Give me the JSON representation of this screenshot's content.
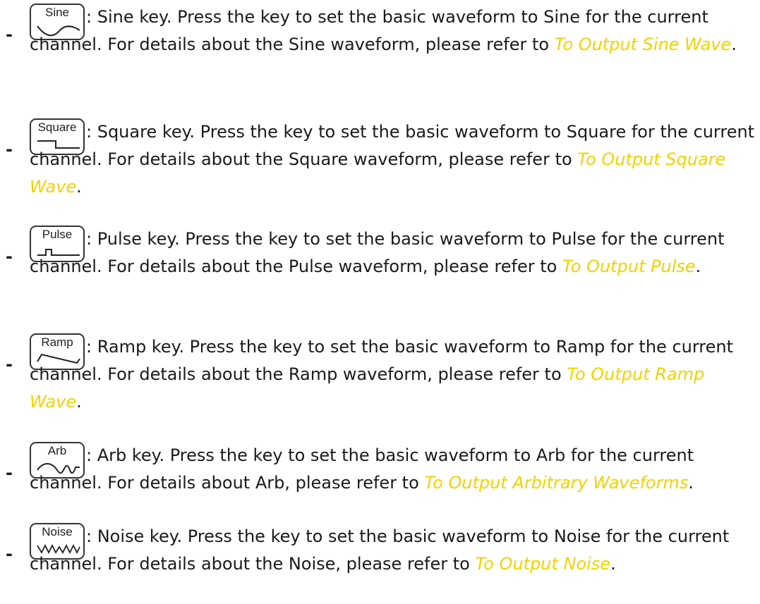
{
  "items": [
    {
      "key_label": "Sine",
      "key_icon": "sine-wave-icon",
      "description": ": Sine key. Press the key to set the basic waveform to Sine for the current channel. For details about the Sine waveform, please refer to ",
      "link": "To Output Sine Wave",
      "end": "."
    },
    {
      "key_label": "Square",
      "key_icon": "square-wave-icon",
      "description": ": Square key. Press the key to set the basic waveform to Square for the current channel. For details about the Square waveform, please refer to ",
      "link": "To Output Square Wave",
      "end": "."
    },
    {
      "key_label": "Pulse",
      "key_icon": "pulse-wave-icon",
      "description": ": Pulse key. Press the key to set the basic waveform to Pulse for the current channel. For details about the Pulse waveform, please refer to ",
      "link": "To Output Pulse",
      "end": "."
    },
    {
      "key_label": "Ramp",
      "key_icon": "ramp-wave-icon",
      "description": ": Ramp key. Press the key to set the basic waveform to Ramp for the current channel. For details about the Ramp waveform, please refer to ",
      "link": "To Output Ramp Wave",
      "end": "."
    },
    {
      "key_label": "Arb",
      "key_icon": "arb-wave-icon",
      "description": ": Arb key. Press the key to set the basic waveform to Arb for the current channel. For details about Arb, please refer to ",
      "link": "To Output Arbitrary Waveforms",
      "end": "."
    },
    {
      "key_label": "Noise",
      "key_icon": "noise-wave-icon",
      "description": ": Noise key. Press the key to set the basic waveform to Noise for the current channel. For details about the Noise, please refer to ",
      "link": "To Output Noise",
      "end": "."
    }
  ],
  "bullet": "-",
  "colors": {
    "text": "#1a1a1a",
    "link": "#f2d200",
    "key_border": "#333333"
  }
}
